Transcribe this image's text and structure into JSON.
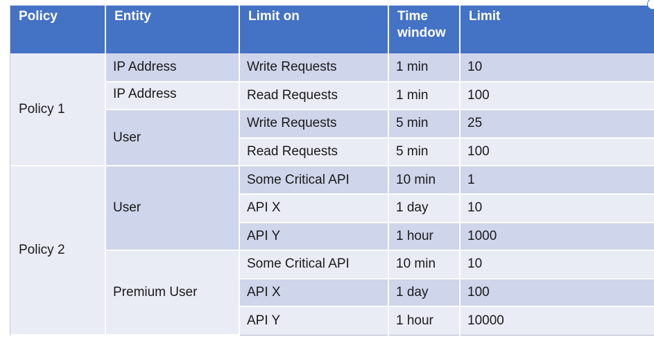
{
  "headers": [
    "Policy",
    "Entity",
    "Limit on",
    "Time\nwindow",
    "Limit"
  ],
  "header_lines": {
    "time_window_1": "Time",
    "time_window_2": "window"
  },
  "policy1": {
    "name": "Policy 1",
    "entity_ip_1": "IP Address",
    "entity_ip_2": "IP Address",
    "entity_user": "User",
    "rows": [
      {
        "limit_on": "Write Requests",
        "window": "1 min",
        "limit": "10"
      },
      {
        "limit_on": "Read Requests",
        "window": "1 min",
        "limit": "100"
      },
      {
        "limit_on": "Write Requests",
        "window": "5 min",
        "limit": "25"
      },
      {
        "limit_on": "Read Requests",
        "window": "5 min",
        "limit": "100"
      }
    ]
  },
  "policy2": {
    "name": "Policy 2",
    "entity_user": "User",
    "entity_premium": "Premium User",
    "rows": [
      {
        "limit_on": "Some Critical API",
        "window": "10 min",
        "limit": "1"
      },
      {
        "limit_on": "API X",
        "window": "1 day",
        "limit": "10"
      },
      {
        "limit_on": "API Y",
        "window": "1 hour",
        "limit": "1000"
      },
      {
        "limit_on": "Some Critical API",
        "window": "10 min",
        "limit": "10"
      },
      {
        "limit_on": "API X",
        "window": "1 day",
        "limit": "100"
      },
      {
        "limit_on": "API Y",
        "window": "1 hour",
        "limit": "10000"
      }
    ]
  },
  "colors": {
    "header": "#4472c4",
    "row_dark": "#cfd5ea",
    "row_light": "#e9ebf5"
  }
}
